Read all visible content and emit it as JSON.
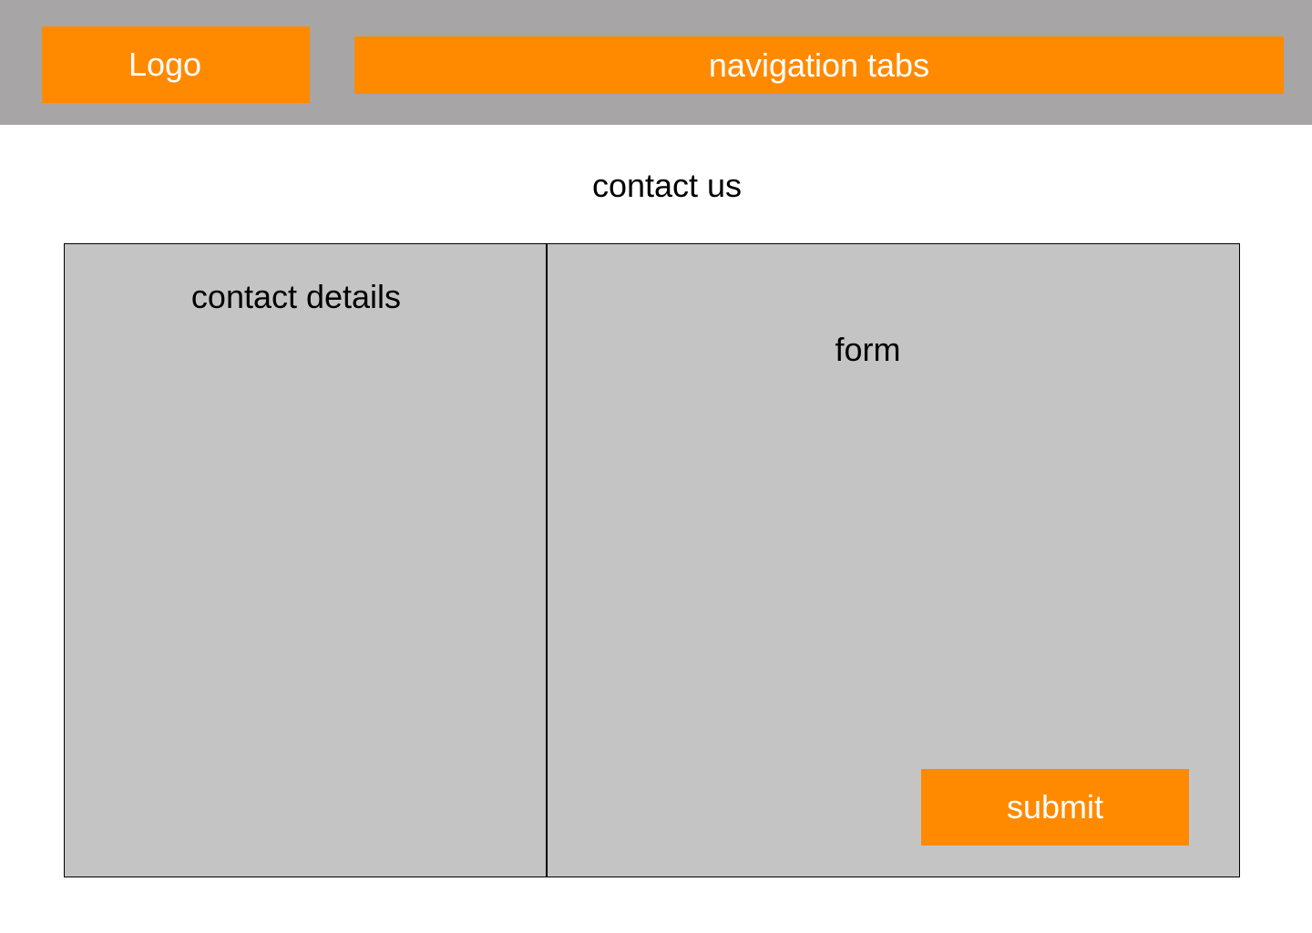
{
  "header": {
    "logo_label": "Logo",
    "nav_label": "navigation tabs"
  },
  "main": {
    "title": "contact us",
    "details_panel": {
      "title": "contact details"
    },
    "form_panel": {
      "title": "form",
      "submit_label": "submit"
    }
  },
  "colors": {
    "accent": "#ff8a00",
    "header_bg": "#a7a5a6",
    "panel_bg": "#c4c4c4"
  }
}
